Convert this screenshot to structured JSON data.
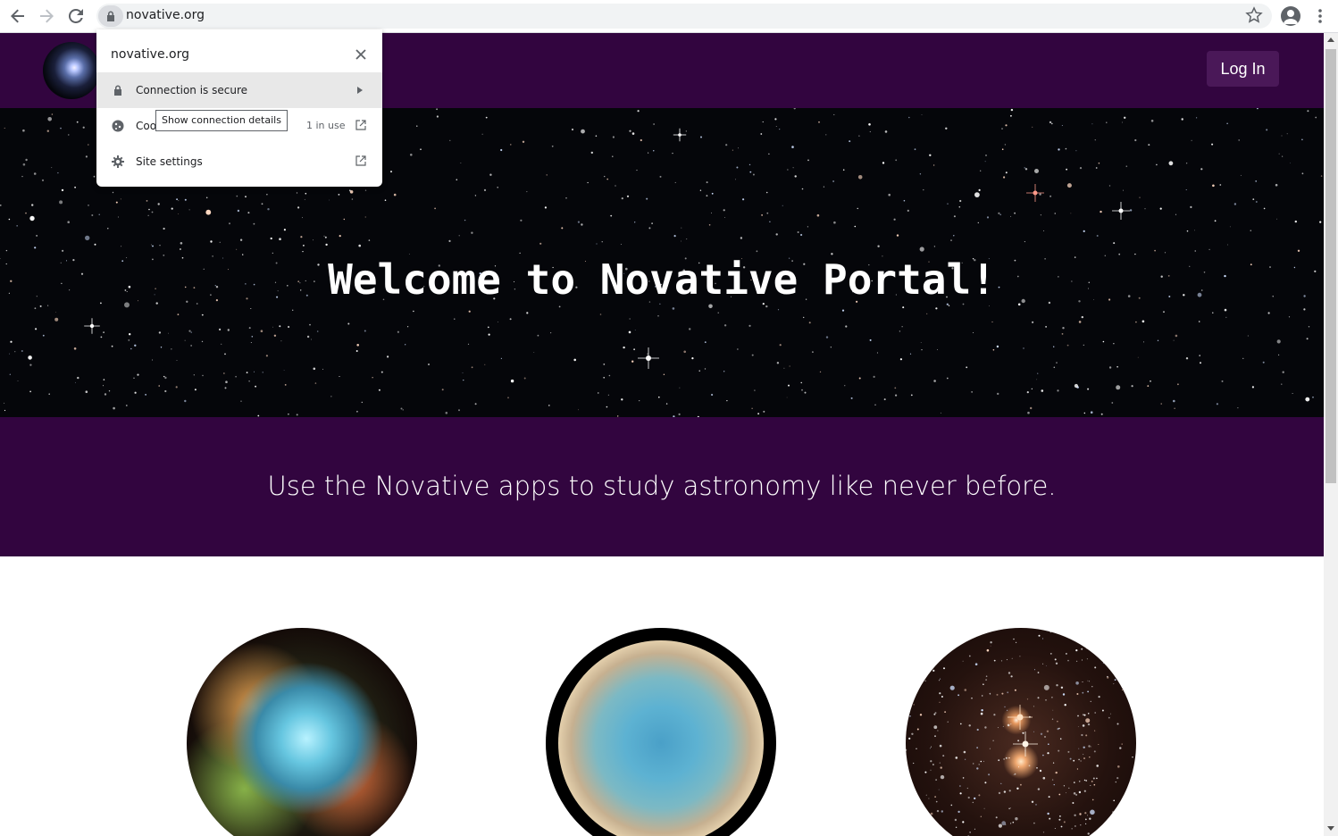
{
  "browser": {
    "url": "novative.org",
    "icons": {
      "back": "arrow-left-icon",
      "forward": "arrow-right-icon",
      "reload": "reload-icon",
      "lock": "lock-icon",
      "bookmark": "star-icon",
      "profile": "profile-icon",
      "menu": "kebab-menu-icon"
    }
  },
  "site_info_popup": {
    "domain": "novative.org",
    "rows": [
      {
        "label": "Connection is secure",
        "icon": "lock-icon",
        "trailing": "chevron-right-icon"
      },
      {
        "label": "Coo",
        "icon": "cookie-icon",
        "trailing_text": "1 in use",
        "trailing": "external-link-icon"
      },
      {
        "label": "Site settings",
        "icon": "gear-icon",
        "trailing": "external-link-icon"
      }
    ],
    "tooltip": "Show connection details",
    "close_icon": "close-icon"
  },
  "site": {
    "login_label": "Log In",
    "hero_title": "Welcome to Novative Portal!",
    "tagline": "Use the Novative apps to study astronomy like never before.",
    "colors": {
      "header_bg": "#32053f",
      "login_bg": "#4a1858",
      "hero_bg": "#05060a"
    }
  }
}
